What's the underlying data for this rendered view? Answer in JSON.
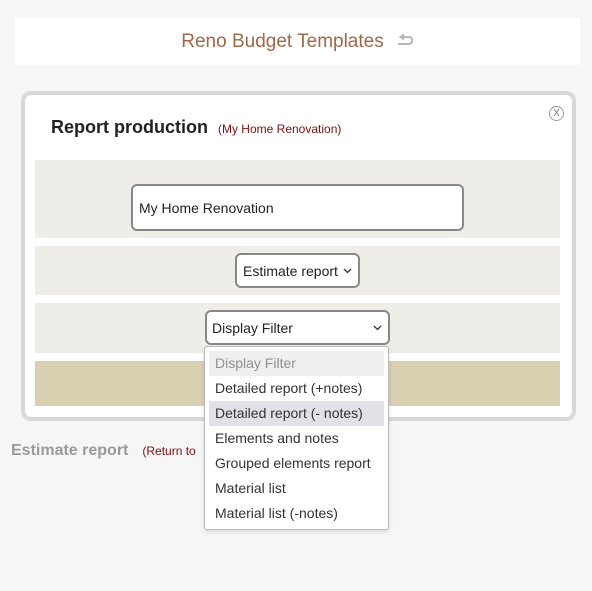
{
  "header": {
    "title": "Reno Budget Templates",
    "undo_icon": "undo-arrow-icon"
  },
  "modal": {
    "title": "Report production",
    "subtitle": "(My Home Renovation)",
    "close_label": "X",
    "project_name_value": "My Home Renovation",
    "report_type": {
      "selected": "Estimate report"
    },
    "filter": {
      "selected": "Display Filter"
    }
  },
  "dropdown": {
    "options": [
      "Display Filter",
      "Detailed report (+notes)",
      "Detailed report (- notes)",
      "Elements and notes",
      "Grouped elements report",
      "Material list",
      "Material list (-notes)"
    ],
    "disabled_index": 0,
    "highlighted_index": 2
  },
  "footer": {
    "label": "Estimate report",
    "return_text": "(Return to"
  },
  "colors": {
    "title_brown": "#a0674a",
    "subtitle_red": "#7a1010",
    "row_bg": "#efede8",
    "action_row_bg": "#d9cfb1"
  }
}
